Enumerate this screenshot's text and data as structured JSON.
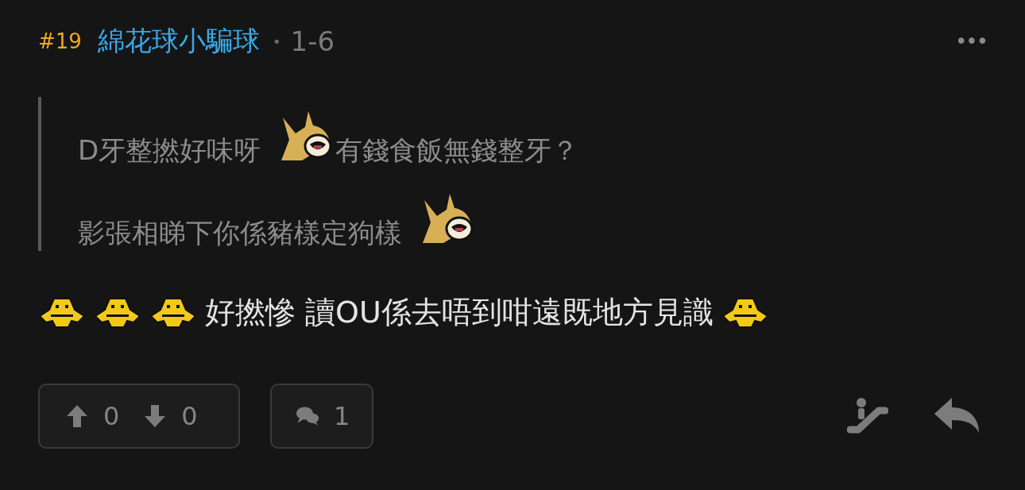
{
  "post": {
    "floor": "#19",
    "author": "綿花球小騙球",
    "separator": "•",
    "time": "1-6",
    "menu": "•••"
  },
  "quote": {
    "lines": [
      [
        {
          "kind": "text",
          "text": "D牙整撚好味呀"
        },
        {
          "kind": "horn"
        },
        {
          "kind": "text",
          "text": "有錢食飯無錢整牙？"
        }
      ],
      [
        {
          "kind": "text",
          "text": "影張相睇下你係豬樣定狗樣"
        },
        {
          "kind": "horn"
        }
      ]
    ]
  },
  "body": [
    {
      "kind": "duck"
    },
    {
      "kind": "duck"
    },
    {
      "kind": "duck"
    },
    {
      "kind": "text",
      "text": "好撚慘 讀OU係去唔到咁遠既地方見識"
    },
    {
      "kind": "duck"
    }
  ],
  "votes": {
    "up": "0",
    "down": "0"
  },
  "replies": "1"
}
